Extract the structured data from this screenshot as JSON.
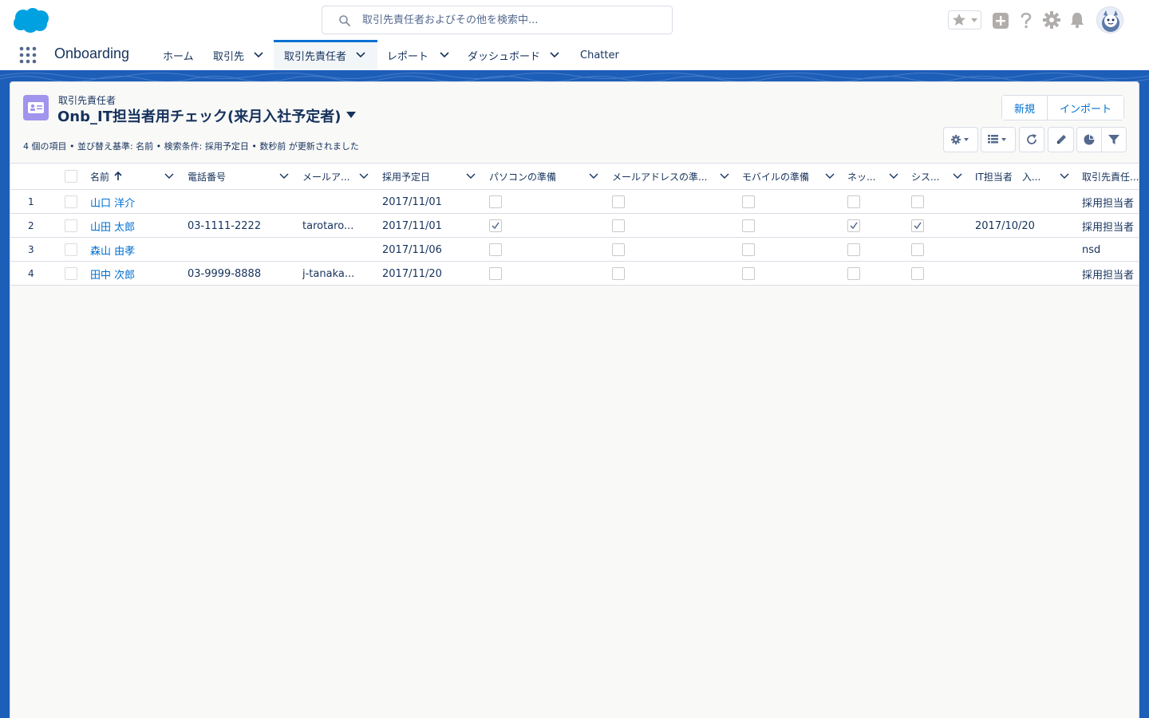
{
  "header": {
    "search_placeholder": "取引先責任者およびその他を検索中..."
  },
  "nav": {
    "app_name": "Onboarding",
    "items": [
      {
        "label": "ホーム"
      },
      {
        "label": "取引先"
      },
      {
        "label": "取引先責任者"
      },
      {
        "label": "レポート"
      },
      {
        "label": "ダッシュボード"
      },
      {
        "label": "Chatter"
      }
    ]
  },
  "list": {
    "object_label": "取引先責任者",
    "title": "Onb_IT担当者用チェック(来月入社予定者)",
    "info": "4 個の項目 • 並び替え基準: 名前 • 検索条件: 採用予定日 • 数秒前 が更新されました",
    "buttons": {
      "new": "新規",
      "import": "インポート"
    }
  },
  "table": {
    "columns": [
      "名前",
      "電話番号",
      "メールア...",
      "採用予定日",
      "パソコンの準備",
      "メールアドレスの準...",
      "モバイルの準備",
      "ネッ...",
      "シス...",
      "IT担当者　入...",
      "取引先責任..."
    ],
    "rows": [
      {
        "num": "1",
        "name": "山口 洋介",
        "phone": "",
        "email": "",
        "hire_date": "2017/11/01",
        "pc": false,
        "mail": false,
        "mobile": false,
        "net": false,
        "sys": false,
        "it_date": "",
        "owner": "採用担当者"
      },
      {
        "num": "2",
        "name": "山田 太郎",
        "phone": "03-1111-2222",
        "email": "tarotaro...",
        "hire_date": "2017/11/01",
        "pc": true,
        "mail": false,
        "mobile": false,
        "net": true,
        "sys": true,
        "it_date": "2017/10/20",
        "owner": "採用担当者"
      },
      {
        "num": "3",
        "name": "森山 由孝",
        "phone": "",
        "email": "",
        "hire_date": "2017/11/06",
        "pc": false,
        "mail": false,
        "mobile": false,
        "net": false,
        "sys": false,
        "it_date": "",
        "owner": "nsd"
      },
      {
        "num": "4",
        "name": "田中 次郎",
        "phone": "03-9999-8888",
        "email": "j-tanaka...",
        "hire_date": "2017/11/20",
        "pc": false,
        "mail": false,
        "mobile": false,
        "net": false,
        "sys": false,
        "it_date": "",
        "owner": "採用担当者"
      }
    ]
  },
  "colors": {
    "brand": "#1d5eb8",
    "link": "#0070d2",
    "text": "#16325c",
    "object_icon": "#a094ed"
  },
  "icons": [
    "salesforce-cloud-logo",
    "search-icon",
    "star-icon",
    "add-icon",
    "help-icon",
    "gear-icon",
    "bell-icon",
    "avatar",
    "app-launcher-icon",
    "contact-card-icon",
    "list-settings-icon",
    "table-view-icon",
    "refresh-icon",
    "pencil-icon",
    "chart-icon",
    "filter-icon"
  ]
}
